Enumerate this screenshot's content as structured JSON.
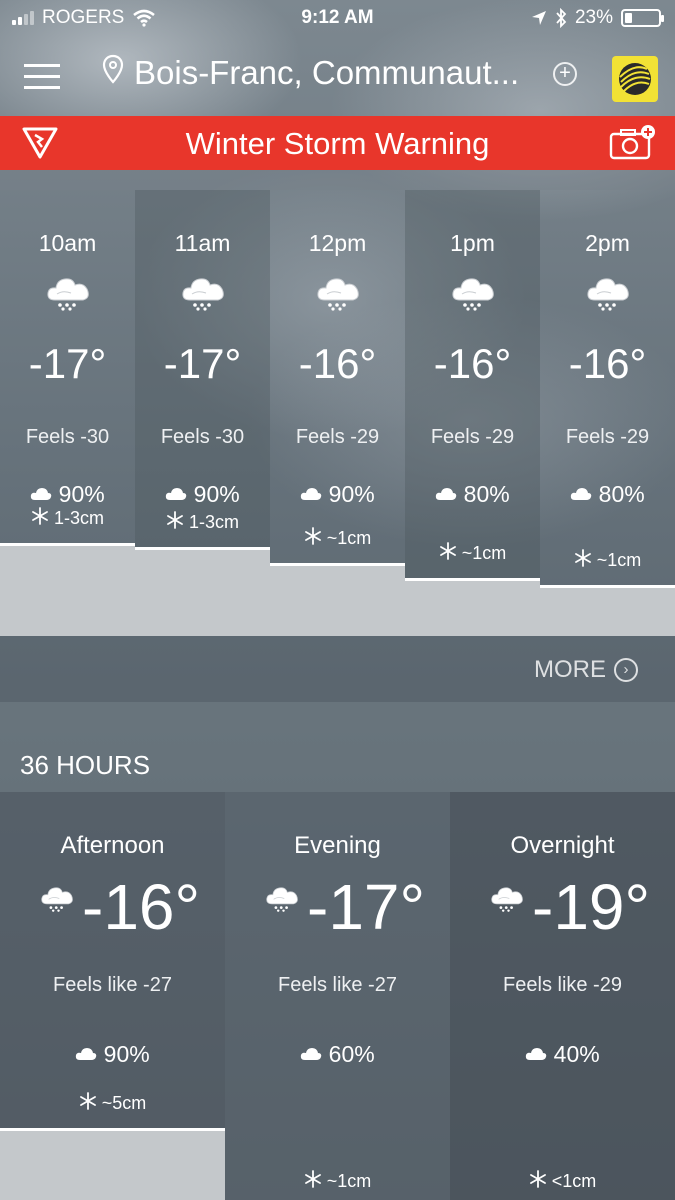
{
  "status_bar": {
    "carrier": "ROGERS",
    "time": "9:12 AM",
    "battery": "23%",
    "battery_level": 0.23,
    "icons": [
      "signal-icon",
      "wifi-icon",
      "location-arrow-icon",
      "bluetooth-icon",
      "battery-icon"
    ]
  },
  "header": {
    "location": "Bois-Franc, Communaut...",
    "icons": [
      "menu-icon",
      "location-pin-icon",
      "add-location-icon",
      "weather-network-logo"
    ]
  },
  "alert": {
    "text": "Winter Storm Warning",
    "color": "#e8362b",
    "icons": [
      "warning-icon",
      "camera-icon"
    ]
  },
  "hourly": {
    "hours": [
      {
        "time": "10am",
        "temp": "-17°",
        "feels": "Feels -30",
        "pop": "90%",
        "accum": "1-3cm",
        "level": 0.86
      },
      {
        "time": "11am",
        "temp": "-17°",
        "feels": "Feels -30",
        "pop": "90%",
        "accum": "1-3cm",
        "level": 0.82
      },
      {
        "time": "12pm",
        "temp": "-16°",
        "feels": "Feels -29",
        "pop": "90%",
        "accum": "~1cm",
        "level": 0.6
      },
      {
        "time": "1pm",
        "temp": "-16°",
        "feels": "Feels -29",
        "pop": "80%",
        "accum": "~1cm",
        "level": 0.4
      },
      {
        "time": "2pm",
        "temp": "-16°",
        "feels": "Feels -29",
        "pop": "80%",
        "accum": "~1cm",
        "level": 0.3
      }
    ],
    "more_label": "MORE"
  },
  "thirty_six": {
    "title": "36 HOURS",
    "periods": [
      {
        "name": "Afternoon",
        "temp": "-16°",
        "feels": "Feels like -27",
        "pop": "90%",
        "accum": "~5cm",
        "level": 0.9
      },
      {
        "name": "Evening",
        "temp": "-17°",
        "feels": "Feels like -27",
        "pop": "60%",
        "accum": "~1cm",
        "level": 0.0
      },
      {
        "name": "Overnight",
        "temp": "-19°",
        "feels": "Feels like -29",
        "pop": "40%",
        "accum": "<1cm",
        "level": 0.0
      }
    ]
  }
}
